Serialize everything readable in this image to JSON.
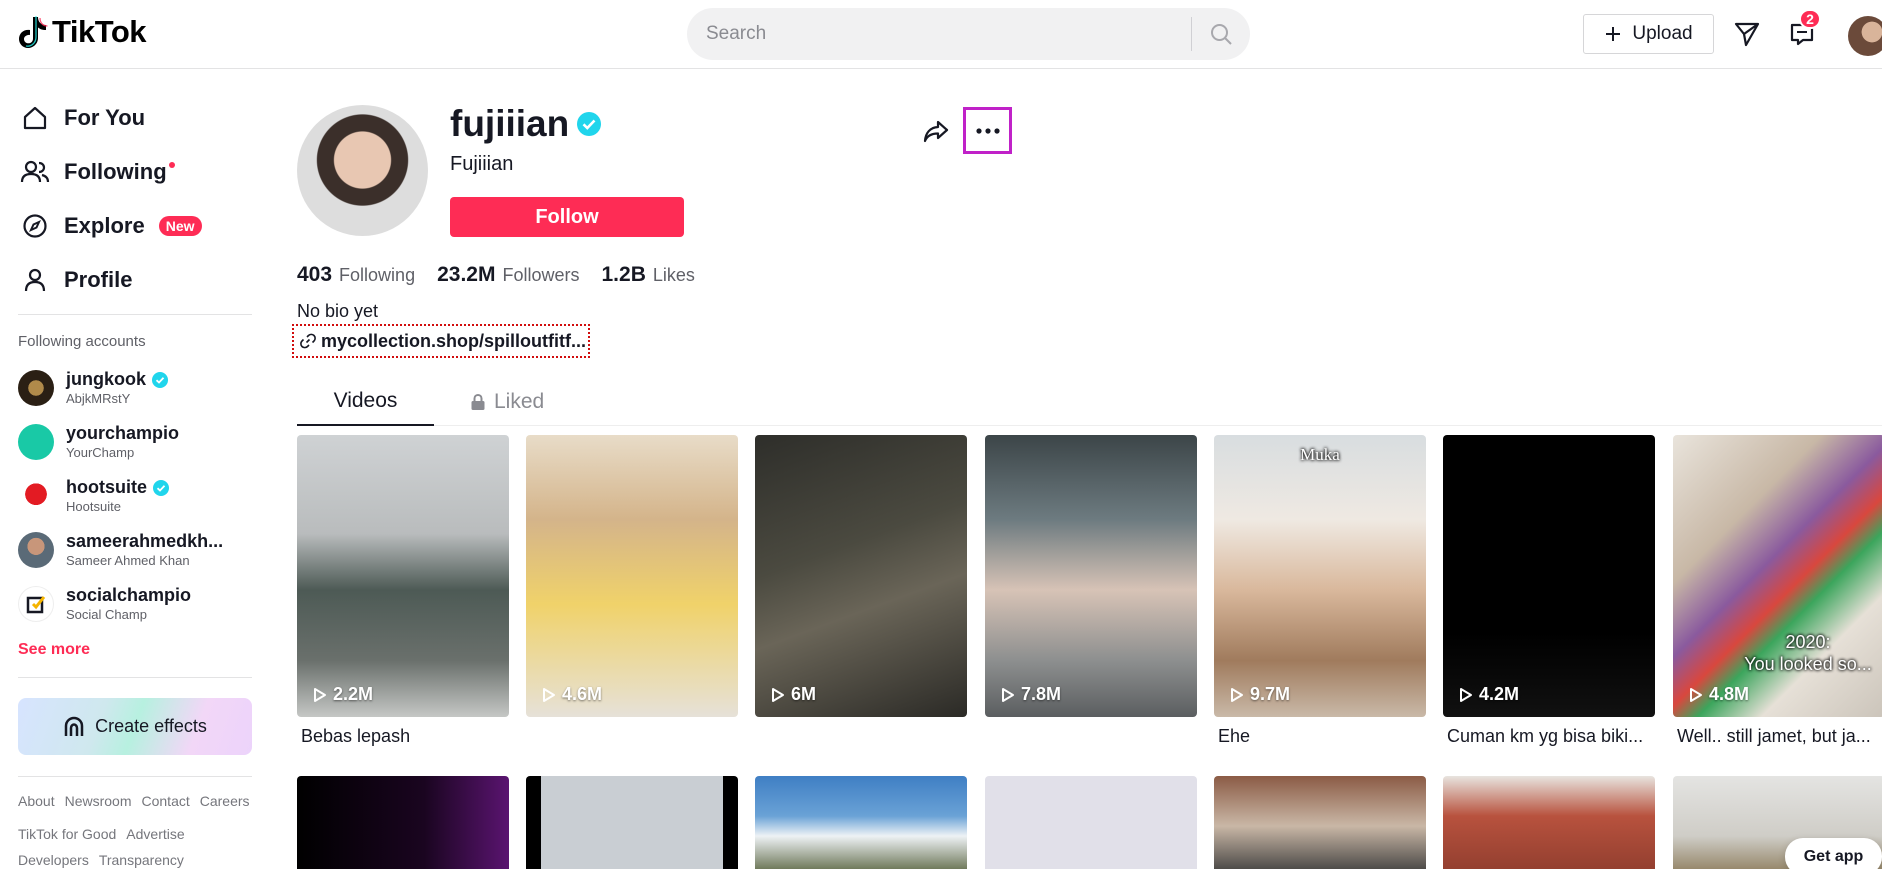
{
  "header": {
    "logo_text": "TikTok",
    "search_placeholder": "Search",
    "upload_label": "Upload",
    "inbox_count": "2"
  },
  "sidebar": {
    "nav": [
      {
        "label": "For You",
        "icon": "home-icon"
      },
      {
        "label": "Following",
        "icon": "users-icon"
      },
      {
        "label": "Explore",
        "icon": "compass-icon",
        "badge": "New"
      },
      {
        "label": "Profile",
        "icon": "person-icon"
      }
    ],
    "following_heading": "Following accounts",
    "accounts": [
      {
        "username": "jungkook",
        "display": "AbjkMRstY",
        "verified": true
      },
      {
        "username": "yourchampio",
        "display": "YourChamp",
        "verified": false
      },
      {
        "username": "hootsuite",
        "display": "Hootsuite",
        "verified": true
      },
      {
        "username": "sameerahmedkh...",
        "display": "Sameer Ahmed Khan",
        "verified": false
      },
      {
        "username": "socialchampio",
        "display": "Social Champ",
        "verified": false
      }
    ],
    "see_more": "See more",
    "create_effects": "Create effects",
    "footer_row1": [
      "About",
      "Newsroom",
      "Contact",
      "Careers"
    ],
    "footer_row2": [
      "TikTok for Good",
      "Advertise"
    ],
    "footer_row3": [
      "Developers",
      "Transparency"
    ]
  },
  "profile": {
    "username": "fujiiian",
    "nickname": "Fujiiian",
    "follow_label": "Follow",
    "stats": [
      {
        "value": "403",
        "label": "Following"
      },
      {
        "value": "23.2M",
        "label": "Followers"
      },
      {
        "value": "1.2B",
        "label": "Likes"
      }
    ],
    "bio": "No bio yet",
    "link": "mycollection.shop/spilloutfitf..."
  },
  "tabs": {
    "videos": "Videos",
    "liked": "Liked"
  },
  "videos": [
    {
      "views": "2.2M",
      "caption": "Bebas lepash"
    },
    {
      "views": "4.6M",
      "caption": ""
    },
    {
      "views": "6M",
      "caption": ""
    },
    {
      "views": "7.8M",
      "caption": ""
    },
    {
      "views": "9.7M",
      "caption": "Ehe",
      "overlay": "Muka"
    },
    {
      "views": "4.2M",
      "caption": "Cuman km yg bisa biki..."
    },
    {
      "views": "4.8M",
      "caption": "Well.. still jamet, but ja...",
      "overlay": "2020:\nYou looked so..."
    }
  ],
  "get_app": "Get app",
  "colors": {
    "accent": "#fe2c55",
    "verified": "#20d5ec",
    "highlight": "#c021c8"
  }
}
